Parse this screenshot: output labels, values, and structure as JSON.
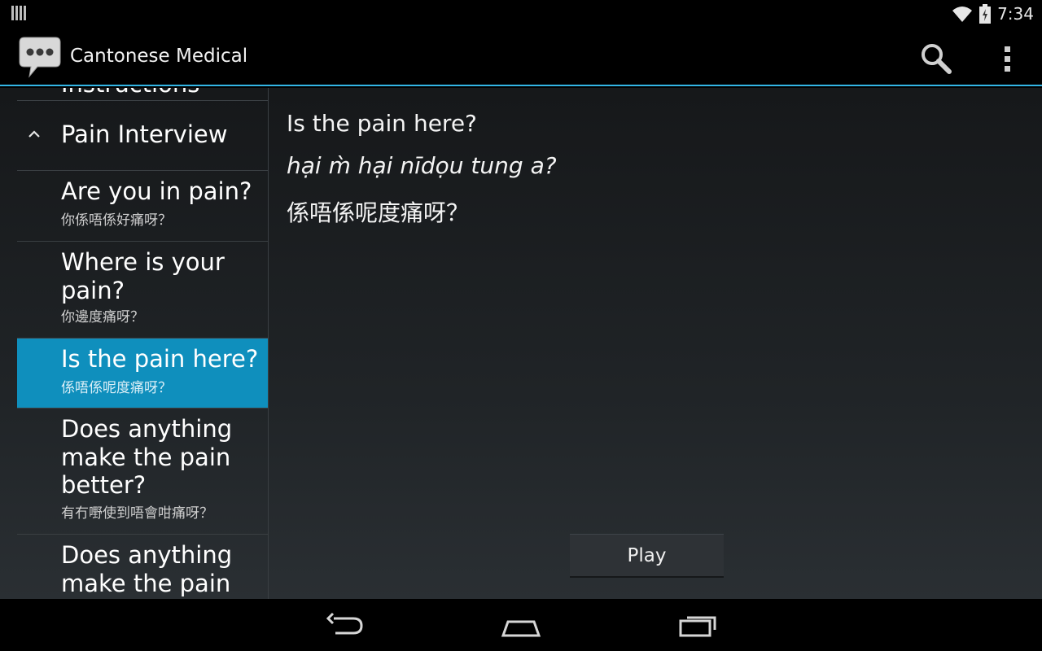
{
  "status_bar": {
    "time": "7:34",
    "icons": [
      "notification-icon",
      "wifi-icon",
      "battery-icon"
    ]
  },
  "action_bar": {
    "title": "Cantonese Medical",
    "icons": [
      "app-speech-bubble-icon",
      "search-icon",
      "overflow-menu-icon"
    ]
  },
  "list": {
    "clipped_item": "Instructions",
    "group": {
      "label": "Pain Interview",
      "expanded": true
    },
    "items": [
      {
        "en": "Are you in pain?",
        "zh": "你係唔係好痛呀？",
        "selected": false
      },
      {
        "en": "Where is your pain?",
        "zh": "你邊度痛呀？",
        "selected": false
      },
      {
        "en": "Is the pain here?",
        "zh": "係唔係呢度痛呀？",
        "selected": true
      },
      {
        "en": "Does anything make the pain better?",
        "zh": "有冇嘢使到唔會咁痛呀？",
        "selected": false
      },
      {
        "en": "Does anything make the pain",
        "zh": "",
        "selected": false
      }
    ]
  },
  "detail": {
    "english": "Is the pain here?",
    "romanization": "hại m̀ hại nīdọu tung a?",
    "chinese": "係唔係呢度痛呀？",
    "play_label": "Play"
  },
  "colors": {
    "accent": "#33b5e5",
    "selected_bg": "#0f8fbd",
    "background": "#000000"
  },
  "nav_bar": {
    "icons": [
      "back-icon",
      "home-icon",
      "recent-apps-icon"
    ]
  }
}
